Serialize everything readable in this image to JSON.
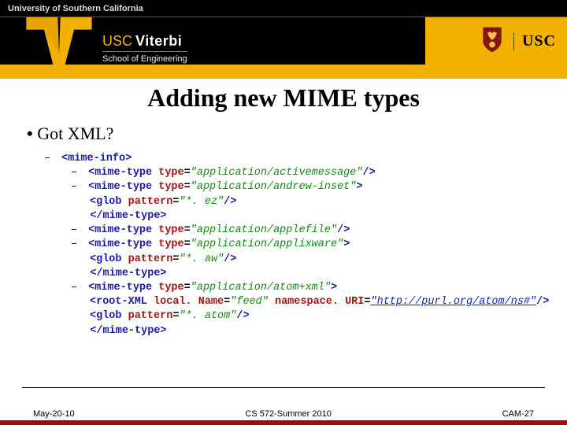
{
  "header": {
    "university_name": "University of Southern California",
    "usc_label": "USC",
    "viterbi_usc": "USC",
    "viterbi_name": "Viterbi",
    "viterbi_school": "School of Engineering"
  },
  "slide": {
    "title": "Adding new MIME types",
    "bullet1": "Got XML?"
  },
  "code": {
    "l1_el": "<mime-info>",
    "l2_el": "<mime-type ",
    "l2_attr": "type",
    "l2_eq": "=",
    "l2_val": "\"application/activemessage\"",
    "l2_close": "/>",
    "l3_el": "<mime-type ",
    "l3_attr": "type",
    "l3_eq": "=",
    "l3_val": "\"application/andrew-inset\"",
    "l3_close": ">",
    "l4_el": "<glob ",
    "l4_attr": "pattern",
    "l4_eq": "=",
    "l4_val": "\"*. ez\"",
    "l4_close": "/>",
    "l5_el": "</mime-type>",
    "l6_el": "<mime-type ",
    "l6_attr": "type",
    "l6_eq": "=",
    "l6_val": "\"application/applefile\"",
    "l6_close": "/>",
    "l7_el": "<mime-type ",
    "l7_attr": "type",
    "l7_eq": "=",
    "l7_val": "\"application/applixware\"",
    "l7_close": ">",
    "l8_el": "<glob ",
    "l8_attr": "pattern",
    "l8_eq": "=",
    "l8_val": "\"*. aw\"",
    "l8_close": "/>",
    "l9_el": "</mime-type>",
    "l10_el": "<mime-type ",
    "l10_attr": "type",
    "l10_eq": "=",
    "l10_val": "\"application/atom+xml\"",
    "l10_close": ">",
    "l11_el": "<root-XML ",
    "l11_attr1": "local. Name",
    "l11_eq1": "=",
    "l11_val1": "\"feed\"",
    "l11_sp": " ",
    "l11_attr2": "namespace. URI",
    "l11_eq2": "=",
    "l11_val2": "\"http://purl.org/atom/ns#\"",
    "l11_close": "/>",
    "l12_el": "<glob ",
    "l12_attr": "pattern",
    "l12_eq": "=",
    "l12_val": "\"*. atom\"",
    "l12_close": "/>",
    "l13_el": "</mime-type>"
  },
  "footer": {
    "left": "May-20-10",
    "center": "CS 572-Summer 2010",
    "right": "CAM-27"
  }
}
